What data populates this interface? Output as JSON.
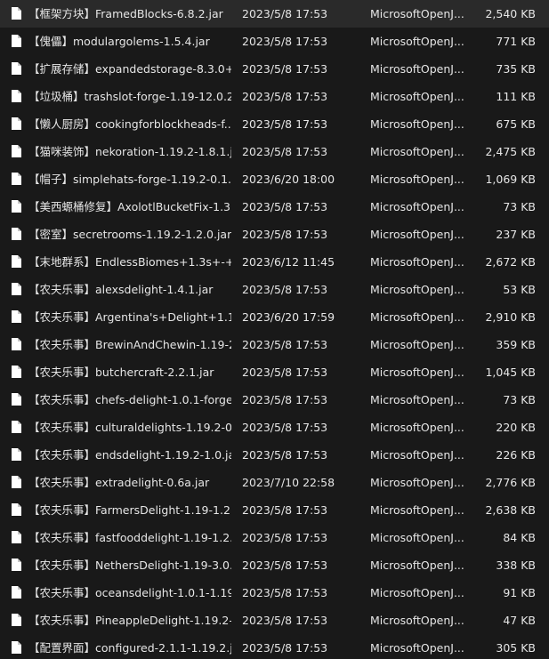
{
  "files": [
    {
      "name": "【框架方块】FramedBlocks-6.8.2.jar",
      "date": "2023/5/8 17:53",
      "type": "MicrosoftOpenJ...",
      "size": "2,540 KB"
    },
    {
      "name": "【傀儡】modulargolems-1.5.4.jar",
      "date": "2023/5/8 17:53",
      "type": "MicrosoftOpenJ...",
      "size": "771 KB"
    },
    {
      "name": "【扩展存储】expandedstorage-8.3.0+...",
      "date": "2023/5/8 17:53",
      "type": "MicrosoftOpenJ...",
      "size": "735 KB"
    },
    {
      "name": "【垃圾桶】trashslot-forge-1.19-12.0.2...",
      "date": "2023/5/8 17:53",
      "type": "MicrosoftOpenJ...",
      "size": "111 KB"
    },
    {
      "name": "【懒人厨房】cookingforblockheads-f...",
      "date": "2023/5/8 17:53",
      "type": "MicrosoftOpenJ...",
      "size": "675 KB"
    },
    {
      "name": "【猫咪装饰】nekoration-1.19.2-1.8.1.jar",
      "date": "2023/5/8 17:53",
      "type": "MicrosoftOpenJ...",
      "size": "2,475 KB"
    },
    {
      "name": "【帽子】simplehats-forge-1.19.2-0.1....",
      "date": "2023/6/20 18:00",
      "type": "MicrosoftOpenJ...",
      "size": "1,069 KB"
    },
    {
      "name": "【美西螈桶修复】AxolotlBucketFix-1.3....",
      "date": "2023/5/8 17:53",
      "type": "MicrosoftOpenJ...",
      "size": "73 KB"
    },
    {
      "name": "【密室】secretrooms-1.19.2-1.2.0.jar",
      "date": "2023/5/8 17:53",
      "type": "MicrosoftOpenJ...",
      "size": "237 KB"
    },
    {
      "name": "【末地群系】EndlessBiomes+1.3s+-+...",
      "date": "2023/6/12 11:45",
      "type": "MicrosoftOpenJ...",
      "size": "2,672 KB"
    },
    {
      "name": "【农夫乐事】alexsdelight-1.4.1.jar",
      "date": "2023/5/8 17:53",
      "type": "MicrosoftOpenJ...",
      "size": "53 KB"
    },
    {
      "name": "【农夫乐事】Argentina's+Delight+1.1....",
      "date": "2023/6/20 17:59",
      "type": "MicrosoftOpenJ...",
      "size": "2,910 KB"
    },
    {
      "name": "【农夫乐事】BrewinAndChewin-1.19-2....",
      "date": "2023/5/8 17:53",
      "type": "MicrosoftOpenJ...",
      "size": "359 KB"
    },
    {
      "name": "【农夫乐事】butchercraft-2.2.1.jar",
      "date": "2023/5/8 17:53",
      "type": "MicrosoftOpenJ...",
      "size": "1,045 KB"
    },
    {
      "name": "【农夫乐事】chefs-delight-1.0.1-forge...",
      "date": "2023/5/8 17:53",
      "type": "MicrosoftOpenJ...",
      "size": "73 KB"
    },
    {
      "name": "【农夫乐事】culturaldelights-1.19.2-0....",
      "date": "2023/5/8 17:53",
      "type": "MicrosoftOpenJ...",
      "size": "220 KB"
    },
    {
      "name": "【农夫乐事】endsdelight-1.19.2-1.0.jar",
      "date": "2023/5/8 17:53",
      "type": "MicrosoftOpenJ...",
      "size": "226 KB"
    },
    {
      "name": "【农夫乐事】extradelight-0.6a.jar",
      "date": "2023/7/10 22:58",
      "type": "MicrosoftOpenJ...",
      "size": "2,776 KB"
    },
    {
      "name": "【农夫乐事】FarmersDelight-1.19-1.2....",
      "date": "2023/5/8 17:53",
      "type": "MicrosoftOpenJ...",
      "size": "2,638 KB"
    },
    {
      "name": "【农夫乐事】fastfooddelight-1.19-1.2....",
      "date": "2023/5/8 17:53",
      "type": "MicrosoftOpenJ...",
      "size": "84 KB"
    },
    {
      "name": "【农夫乐事】NethersDelight-1.19-3.0.j...",
      "date": "2023/5/8 17:53",
      "type": "MicrosoftOpenJ...",
      "size": "338 KB"
    },
    {
      "name": "【农夫乐事】oceansdelight-1.0.1-1.19....",
      "date": "2023/5/8 17:53",
      "type": "MicrosoftOpenJ...",
      "size": "91 KB"
    },
    {
      "name": "【农夫乐事】PineappleDelight-1.19.2-...",
      "date": "2023/5/8 17:53",
      "type": "MicrosoftOpenJ...",
      "size": "47 KB"
    },
    {
      "name": "【配置界面】configured-2.1.1-1.19.2.jar",
      "date": "2023/5/8 17:53",
      "type": "MicrosoftOpenJ...",
      "size": "305 KB"
    }
  ],
  "icon": "file-icon",
  "colors": {
    "background": "#191919",
    "text": "#e6e6e6",
    "icon": "#ffffff"
  }
}
